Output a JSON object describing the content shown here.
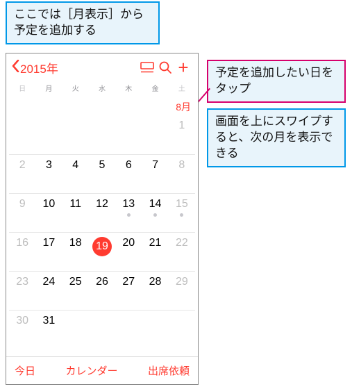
{
  "callouts": {
    "top": "ここでは［月表示］から予定を追加する",
    "tap": "予定を追加したい日をタップ",
    "swipe": "画面を上にスワイプすると、次の月を表示できる"
  },
  "nav": {
    "back": "2015年"
  },
  "month_label": "8月",
  "weekdays": [
    "日",
    "月",
    "火",
    "水",
    "木",
    "金",
    "土"
  ],
  "weeks": [
    [
      null,
      null,
      null,
      null,
      null,
      null,
      {
        "n": 1,
        "dim": true
      }
    ],
    [
      {
        "n": 2,
        "dim": true
      },
      {
        "n": 3
      },
      {
        "n": 4
      },
      {
        "n": 5
      },
      {
        "n": 6
      },
      {
        "n": 7
      },
      {
        "n": 8,
        "dim": true
      }
    ],
    [
      {
        "n": 9,
        "dim": true
      },
      {
        "n": 10
      },
      {
        "n": 11
      },
      {
        "n": 12
      },
      {
        "n": 13,
        "dot": true
      },
      {
        "n": 14,
        "dot": true
      },
      {
        "n": 15,
        "dim": true,
        "dot": true
      }
    ],
    [
      {
        "n": 16,
        "dim": true
      },
      {
        "n": 17
      },
      {
        "n": 18
      },
      {
        "n": 19,
        "today": true
      },
      {
        "n": 20
      },
      {
        "n": 21
      },
      {
        "n": 22,
        "dim": true
      }
    ],
    [
      {
        "n": 23,
        "dim": true
      },
      {
        "n": 24
      },
      {
        "n": 25
      },
      {
        "n": 26
      },
      {
        "n": 27
      },
      {
        "n": 28
      },
      {
        "n": 29,
        "dim": true
      }
    ],
    [
      {
        "n": 30,
        "dim": true
      },
      {
        "n": 31
      },
      null,
      null,
      null,
      null,
      null
    ]
  ],
  "bottom": {
    "today": "今日",
    "calendars": "カレンダー",
    "inbox": "出席依頼"
  }
}
